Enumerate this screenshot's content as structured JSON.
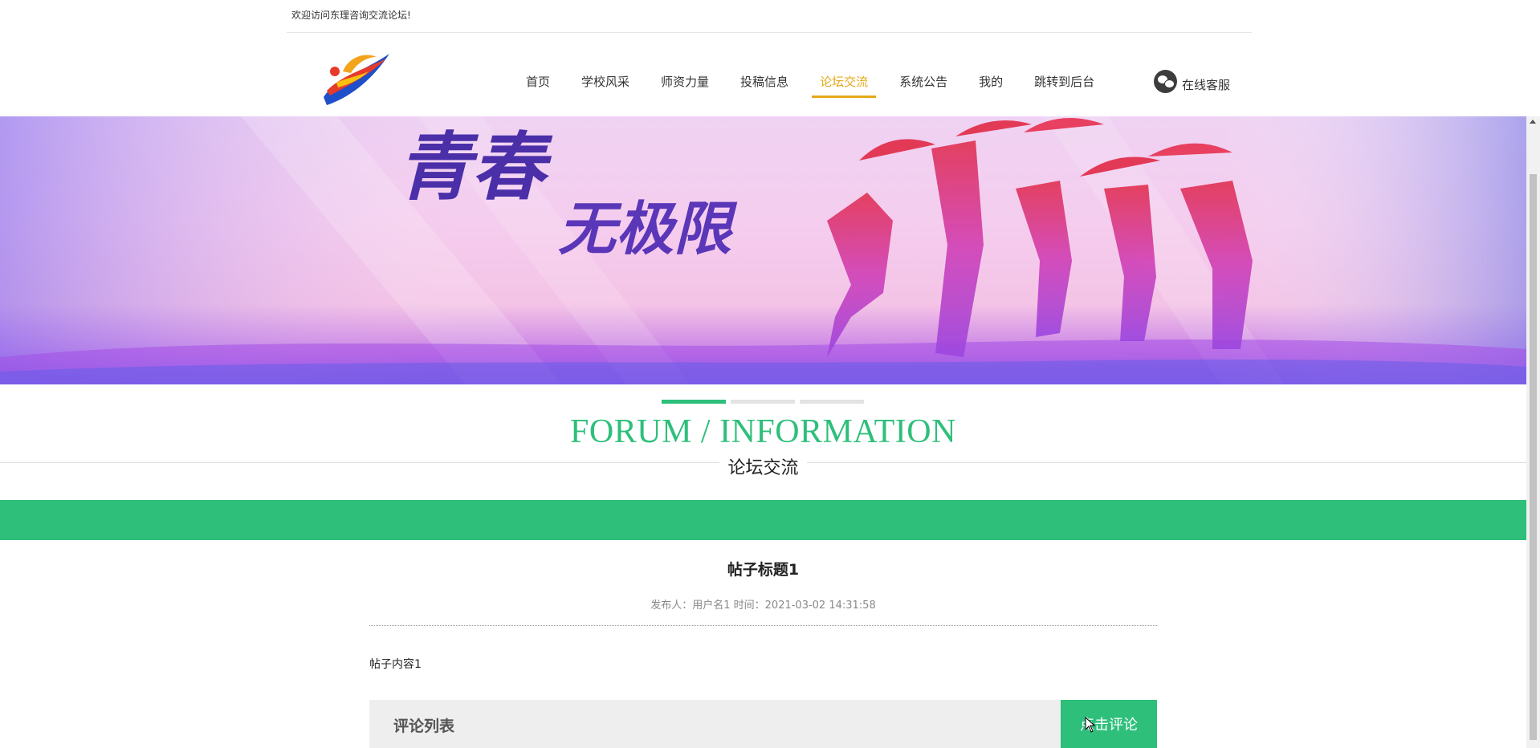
{
  "topbar": {
    "welcome": "欢迎访问东理咨询交流论坛!"
  },
  "header": {
    "logo": "logo-image",
    "nav": [
      {
        "label": "首页",
        "active": false
      },
      {
        "label": "学校风采",
        "active": false
      },
      {
        "label": "师资力量",
        "active": false
      },
      {
        "label": "投稿信息",
        "active": false
      },
      {
        "label": "论坛交流",
        "active": true
      },
      {
        "label": "系统公告",
        "active": false
      },
      {
        "label": "我的",
        "active": false
      },
      {
        "label": "跳转到后台",
        "active": false
      }
    ],
    "service": {
      "label": "在线客服",
      "icon": "wechat-icon"
    }
  },
  "banner": {
    "headline": "青春",
    "subline": "无极限",
    "slides": 3,
    "active_slide": 1
  },
  "section": {
    "title_en": "FORUM / INFORMATION",
    "title_cn": "论坛交流"
  },
  "post": {
    "title": "帖子标题1",
    "meta": "发布人：用户名1 时间：2021-03-02 14:31:58",
    "content": "帖子内容1"
  },
  "comments": {
    "title": "评论列表",
    "button": "点击评论"
  },
  "colors": {
    "accent": "#2ebf7b",
    "nav_active": "#e5a918"
  }
}
